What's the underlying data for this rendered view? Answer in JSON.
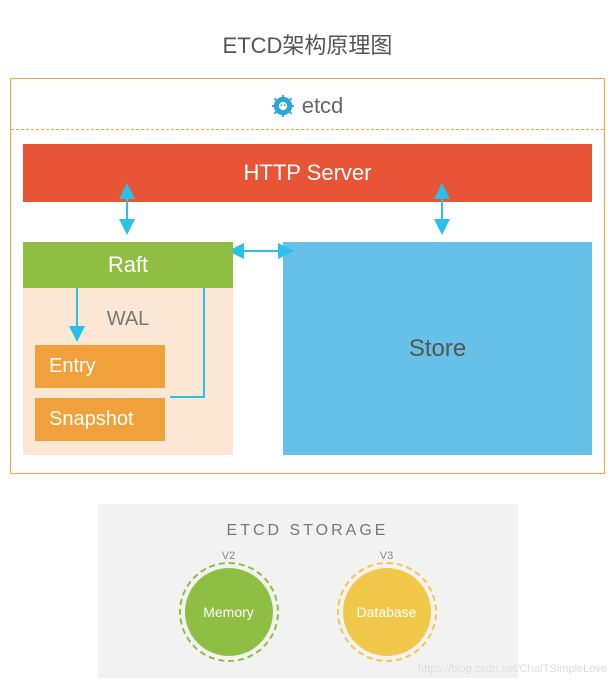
{
  "title": "ETCD架构原理图",
  "header": {
    "label": "etcd",
    "icon": "gear-icon"
  },
  "blocks": {
    "http_server": "HTTP Server",
    "raft": "Raft",
    "wal": {
      "title": "WAL",
      "entry": "Entry",
      "snapshot": "Snapshot"
    },
    "store": "Store"
  },
  "storage": {
    "title": "ETCD  STORAGE",
    "v2": {
      "version": "V2",
      "label": "Memory"
    },
    "v3": {
      "version": "V3",
      "label": "Database"
    }
  },
  "colors": {
    "http_server": "#e75436",
    "raft": "#8ebf42",
    "wal_bg": "#fbe7d3",
    "wal_block": "#f0a13c",
    "store": "#66c0e7",
    "border": "#f4a24a",
    "arrow": "#29c1e8",
    "memory": "#8ebf42",
    "database": "#f2c84b"
  },
  "watermark": "https://blog.csdn.net/ChaITSimpleLove",
  "connections": [
    {
      "from": "http_server",
      "to": "raft",
      "dir": "bidirectional"
    },
    {
      "from": "http_server",
      "to": "store",
      "dir": "bidirectional"
    },
    {
      "from": "raft",
      "to": "store",
      "dir": "bidirectional"
    },
    {
      "from": "raft",
      "to": "entry",
      "dir": "bidirectional"
    },
    {
      "from": "raft",
      "to": "snapshot",
      "dir": "unidirectional"
    }
  ]
}
